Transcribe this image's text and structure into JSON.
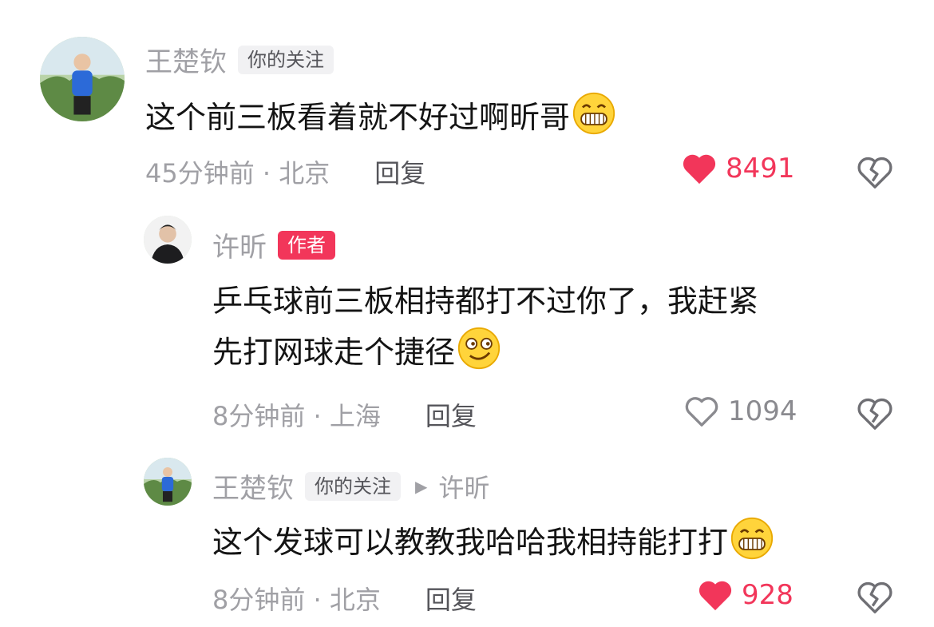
{
  "colors": {
    "accent": "#f2365a",
    "name": "#a0a0a5",
    "text": "#141414",
    "badge_bg": "#f1f1f3"
  },
  "comments": [
    {
      "user": "王楚钦",
      "badge": "你的关注",
      "text": "这个前三板看着就不好过啊昕哥",
      "emoji": "grin-emoji",
      "time_location": "45分钟前 · 北京",
      "reply_label": "回复",
      "likes": "8491",
      "liked": true
    },
    {
      "user": "许昕",
      "badge": "作者",
      "text_line1": "乒乓球前三板相持都打不过你了，我赶紧",
      "text_line2": "先打网球走个捷径",
      "emoji": "smirk-emoji",
      "time_location": "8分钟前 · 上海",
      "reply_label": "回复",
      "likes": "1094",
      "liked": false
    },
    {
      "user": "王楚钦",
      "badge": "你的关注",
      "reply_to": "许昕",
      "text": "这个发球可以教教我哈哈我相持能打打",
      "emoji": "grin-emoji",
      "time_location": "8分钟前 · 北京",
      "reply_label": "回复",
      "likes": "928",
      "liked": true
    }
  ]
}
